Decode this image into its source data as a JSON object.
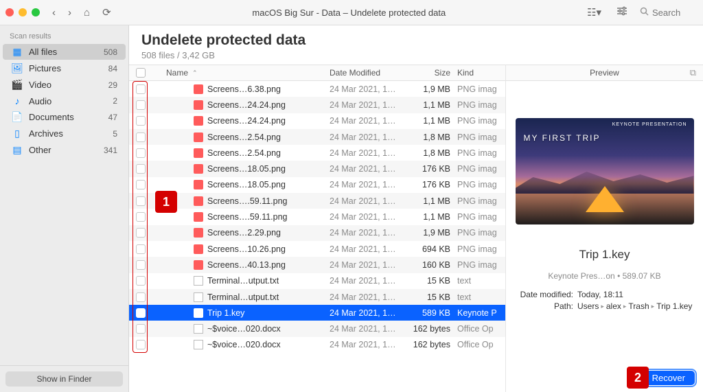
{
  "toolbar": {
    "title": "macOS Big Sur - Data – Undelete protected data",
    "search_placeholder": "Search"
  },
  "sidebar": {
    "header": "Scan results",
    "items": [
      {
        "icon": "grid",
        "label": "All files",
        "count": "508",
        "selected": true
      },
      {
        "icon": "pic",
        "label": "Pictures",
        "count": "84"
      },
      {
        "icon": "vid",
        "label": "Video",
        "count": "29"
      },
      {
        "icon": "aud",
        "label": "Audio",
        "count": "2"
      },
      {
        "icon": "doc",
        "label": "Documents",
        "count": "47"
      },
      {
        "icon": "arc",
        "label": "Archives",
        "count": "5"
      },
      {
        "icon": "oth",
        "label": "Other",
        "count": "341"
      }
    ],
    "footer_button": "Show in Finder"
  },
  "main": {
    "title": "Undelete protected data",
    "subtitle": "508 files / 3,42 GB",
    "columns": {
      "name": "Name",
      "date": "Date Modified",
      "size": "Size",
      "kind": "Kind"
    },
    "rows": [
      {
        "icon": "png",
        "name": "Screens…6.38.png",
        "date": "24 Mar 2021, 1…",
        "size": "1,9 MB",
        "kind": "PNG imag"
      },
      {
        "icon": "png",
        "name": "Screens…24.24.png",
        "date": "24 Mar 2021, 1…",
        "size": "1,1 MB",
        "kind": "PNG imag"
      },
      {
        "icon": "png",
        "name": "Screens…24.24.png",
        "date": "24 Mar 2021, 1…",
        "size": "1,1 MB",
        "kind": "PNG imag"
      },
      {
        "icon": "png",
        "name": "Screens…2.54.png",
        "date": "24 Mar 2021, 1…",
        "size": "1,8 MB",
        "kind": "PNG imag"
      },
      {
        "icon": "png",
        "name": "Screens…2.54.png",
        "date": "24 Mar 2021, 1…",
        "size": "1,8 MB",
        "kind": "PNG imag"
      },
      {
        "icon": "png",
        "name": "Screens…18.05.png",
        "date": "24 Mar 2021, 1…",
        "size": "176 KB",
        "kind": "PNG imag"
      },
      {
        "icon": "png",
        "name": "Screens…18.05.png",
        "date": "24 Mar 2021, 1…",
        "size": "176 KB",
        "kind": "PNG imag"
      },
      {
        "icon": "png",
        "name": "Screens….59.11.png",
        "date": "24 Mar 2021, 1…",
        "size": "1,1 MB",
        "kind": "PNG imag"
      },
      {
        "icon": "png",
        "name": "Screens….59.11.png",
        "date": "24 Mar 2021, 1…",
        "size": "1,1 MB",
        "kind": "PNG imag"
      },
      {
        "icon": "png",
        "name": "Screens…2.29.png",
        "date": "24 Mar 2021, 1…",
        "size": "1,9 MB",
        "kind": "PNG imag"
      },
      {
        "icon": "png",
        "name": "Screens…10.26.png",
        "date": "24 Mar 2021, 1…",
        "size": "694 KB",
        "kind": "PNG imag"
      },
      {
        "icon": "png",
        "name": "Screens…40.13.png",
        "date": "24 Mar 2021, 1…",
        "size": "160 KB",
        "kind": "PNG imag"
      },
      {
        "icon": "txt",
        "name": "Terminal…utput.txt",
        "date": "24 Mar 2021, 1…",
        "size": "15 KB",
        "kind": "text"
      },
      {
        "icon": "txt",
        "name": "Terminal…utput.txt",
        "date": "24 Mar 2021, 1…",
        "size": "15 KB",
        "kind": "text"
      },
      {
        "icon": "key",
        "name": "Trip 1.key",
        "date": "24 Mar 2021, 1…",
        "size": "589 KB",
        "kind": "Keynote P",
        "selected": true
      },
      {
        "icon": "docx",
        "name": "~$voice…020.docx",
        "date": "24 Mar 2021, 1…",
        "size": "162 bytes",
        "kind": "Office Op"
      },
      {
        "icon": "docx",
        "name": "~$voice…020.docx",
        "date": "24 Mar 2021, 1…",
        "size": "162 bytes",
        "kind": "Office Op"
      }
    ]
  },
  "callouts": {
    "one": "1",
    "two": "2"
  },
  "preview": {
    "header": "Preview",
    "thumb": {
      "tag": "KEYNOTE PRESENTATION",
      "title": "MY FIRST TRIP"
    },
    "name": "Trip 1.key",
    "sub": "Keynote Pres…on • 589.07 KB",
    "fields": {
      "date_k": "Date modified:",
      "date_v": "Today, 18:11",
      "path_k": "Path:",
      "path_parts": [
        "Users",
        "alex",
        "Trash",
        "Trip 1.key"
      ]
    },
    "recover": "Recover"
  }
}
